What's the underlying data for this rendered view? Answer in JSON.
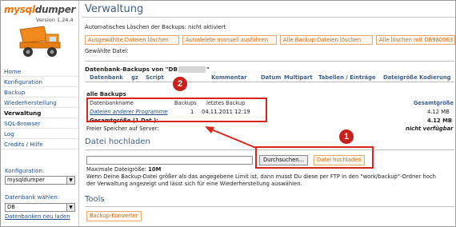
{
  "sidebar": {
    "logo_part1": "mysql",
    "logo_part2": "dumper",
    "version": "Version 1.24.4",
    "nav": [
      "Home",
      "Konfiguration",
      "Backup",
      "Wiederherstellung",
      "Verwaltung",
      "SQL-Browser",
      "Log",
      "Credits / Hilfe"
    ],
    "active_nav": "Verwaltung",
    "config_label": "Konfiguration:",
    "config_value": "mysqldumper",
    "db_label": "Datenbank wählen:",
    "db_value": "DB",
    "db_link": "Datenbanken neu laden"
  },
  "main": {
    "title": "Verwaltung",
    "autodelete_status": "Automatisches Löschen der Backups: nicht aktiviert",
    "buttons": {
      "delete_selected": "Ausgewählte Dateien löschen",
      "autodelete_manual": "Autodelete manuell ausführen",
      "delete_all_backups": "Alle Backup-Dateien löschen",
      "delete_all_db": "Alle löschen mit DB980063"
    },
    "selected_file": "Gewählte Datei:",
    "table_title_prefix": "Datenbank-Backups von \"DB",
    "table_title_suffix": "\"",
    "columns": [
      "Datenbank",
      "gz",
      "Script",
      "Kommentar",
      "Datum",
      "Multipart",
      "Tabellen / Einträge",
      "Dateigröße",
      "Kodierung"
    ],
    "all_backups": "alle Backups",
    "summary_headers": {
      "db_name": "Datenbankname",
      "backups": "Backups",
      "last_backup": "letztes Backup",
      "total": "Gesamtgröße"
    },
    "row": {
      "name": "Dateien anderer Programme",
      "backups": "1",
      "date": "04.11.2011 12:19",
      "size": "4.12 MB"
    },
    "total_row": {
      "label": "Gesamtgröße (1 Dat.):",
      "size": "4.12 MB"
    },
    "free_space": {
      "label": "Freier Speicher auf Server:",
      "value": "nicht verfügbar"
    },
    "upload": {
      "title": "Datei hochladen",
      "browse": "Durchsuchen...",
      "upload_button": "Datei hochladen",
      "max_size_label": "Maximale Dateigröße:",
      "max_size_value": "10M",
      "info_line1": "Wenn Deine Backup-Datei größer als das angegebene Limit ist, dann musst Du diese per FTP in den \"work/backup\"-Ordner hoch",
      "info_line2": "der Verwaltung angezeigt und lässt sich für eine Wiederherstellung auswählen."
    },
    "tools": {
      "title": "Tools",
      "converter": "Backup-Konverter"
    }
  },
  "annotations": {
    "marker1": "1",
    "marker2": "2",
    "color": "#d9261c"
  }
}
